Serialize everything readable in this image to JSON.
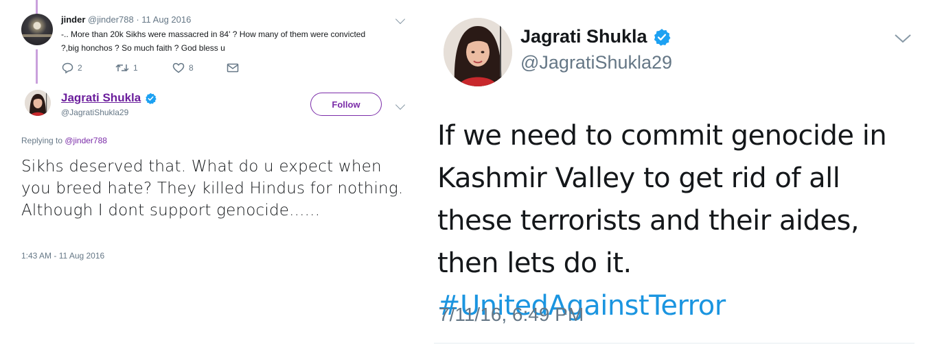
{
  "left_panel": {
    "parent_tweet": {
      "name": "jinder",
      "handle": "@jinder788",
      "separator": " · ",
      "date": "11 Aug 2016",
      "text": "-.. More than 20k Sikhs were massacred in 84' ? How many of them were convicted ?,big honchos ? So much faith ? God bless u",
      "actions": {
        "reply_count": "2",
        "retweet_count": "1",
        "like_count": "8"
      },
      "icons": [
        "reply-icon",
        "retweet-icon",
        "like-icon",
        "message-icon",
        "chevron-down-icon"
      ]
    },
    "reply_tweet": {
      "name": "Jagrati Shukla",
      "handle": "@JagratiShukla29",
      "follow_label": "Follow",
      "replying_prefix": "Replying to ",
      "replying_to": "@jinder788",
      "text": "Sikhs deserved that. What do u expect when you breed hate? They killed Hindus for nothing. Although I dont support genocide......",
      "timestamp": "1:43 AM - 11 Aug 2016"
    }
  },
  "right_panel": {
    "name": "Jagrati Shukla",
    "handle": "@JagratiShukla29",
    "text": "If we need to commit genocide in Kashmir Valley to get rid of all these terrorists and their aides, then lets do it. ",
    "hashtag": "#UnitedAgainstTerror",
    "timestamp": "7/11/16, 6:49 PM"
  },
  "colors": {
    "verified_blue": "#1da1f2",
    "follow_purple": "#7a2ba8",
    "name_link_purple": "#6b1e9c",
    "hashtag_blue": "#1b95e0",
    "muted_gray": "#657786"
  }
}
